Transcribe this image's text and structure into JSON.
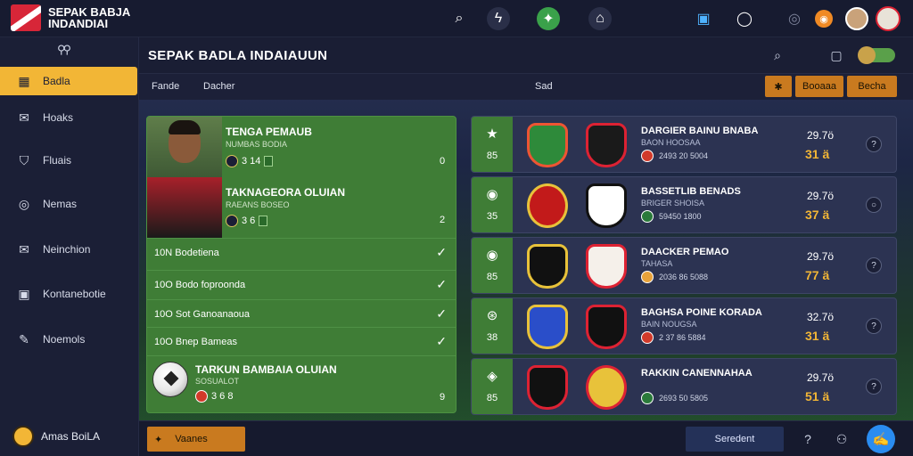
{
  "app": {
    "title_line1": "SEPAK BABJA",
    "title_line2": "INDANDIAI"
  },
  "topbar_icons": [
    "search-icon",
    "lightning-icon",
    "soccer-icon",
    "home-icon",
    "phone-icon",
    "chat-icon",
    "settings-icon",
    "coin-icon",
    "avatar",
    "club-avatar"
  ],
  "sidebar": {
    "search_glyph": "⚲⚲",
    "items": [
      {
        "label": "Badla",
        "icon": "grid-icon",
        "active": true
      },
      {
        "label": "Hoaks",
        "icon": "inbox-icon"
      },
      {
        "label": "Fluais",
        "icon": "shield-icon"
      },
      {
        "label": "Nemas",
        "icon": "pin-icon"
      },
      {
        "label": "Neinchion",
        "icon": "mail-icon"
      },
      {
        "label": "Kontanebotie",
        "icon": "image-icon"
      },
      {
        "label": "Noemols",
        "icon": "message-icon"
      }
    ],
    "footer_label": "Amas BoiLA"
  },
  "header": {
    "title": "SEPAK BADLA INDAIAUUN"
  },
  "subbar": {
    "tabs": [
      "Fande",
      "Dacher",
      "Sad"
    ],
    "btn_icon": "✱",
    "btn_1": "Booaaa",
    "btn_2": "Becha"
  },
  "left_panel": {
    "card1": {
      "name": "TENGA PEMAUB",
      "sub": "NUMBAS BODIA",
      "stat": "3 14",
      "num": "0"
    },
    "card2": {
      "name": "TAKNAGEORA OLUIAN",
      "sub": "RAEANS BOSEO",
      "stat": "3 6",
      "num": "2"
    },
    "rows": [
      {
        "time": "10N",
        "label": "Bodetiena"
      },
      {
        "time": "10O",
        "label": "Bodo foproonda"
      },
      {
        "time": "10O",
        "label": "Sot Ganoanaoua"
      },
      {
        "time": "10O",
        "label": "Bnep Bameas"
      }
    ],
    "card3": {
      "name": "TARKUN BAMBAIA OLUIAN",
      "sub": "SOSUALOT",
      "stat": "3 6 8",
      "num": "9"
    }
  },
  "matches": [
    {
      "icon": "★",
      "minute": "85",
      "title": "DARGIER BAINU BNABA",
      "sub": "BAON HOOSAA",
      "meta": "2493 20 5004",
      "odds": "29.7ö",
      "score": "31 ä"
    },
    {
      "icon": "◉",
      "minute": "35",
      "title": "BASSETLIB BENADS",
      "sub": "BRIGER SHOISA",
      "meta": "59450 1800",
      "odds": "29.7ö",
      "score": "37 ä"
    },
    {
      "icon": "◉",
      "minute": "85",
      "title": "DAACKER PEMAO",
      "sub": "TAHASA",
      "meta": "2036 86 5088",
      "odds": "29.7ö",
      "score": "77 ä"
    },
    {
      "icon": "⊛",
      "minute": "38",
      "title": "BAGHSA POINE KORADA",
      "sub": "BAIN NOUGSA",
      "meta": "2 37 86 5884",
      "odds": "32.7ö",
      "score": "31 ä"
    },
    {
      "icon": "◈",
      "minute": "85",
      "title": "RAKKIN CANENNAHAA",
      "sub": "",
      "meta": "2693 50 5805",
      "odds": "29.7ö",
      "score": "51 ä"
    }
  ],
  "bottombar": {
    "btn_label": "Vaanes",
    "select_label": "Seredent"
  },
  "colors": {
    "accent": "#f2b636",
    "green": "#3f7d36",
    "nav_bg": "#1b1f36"
  }
}
